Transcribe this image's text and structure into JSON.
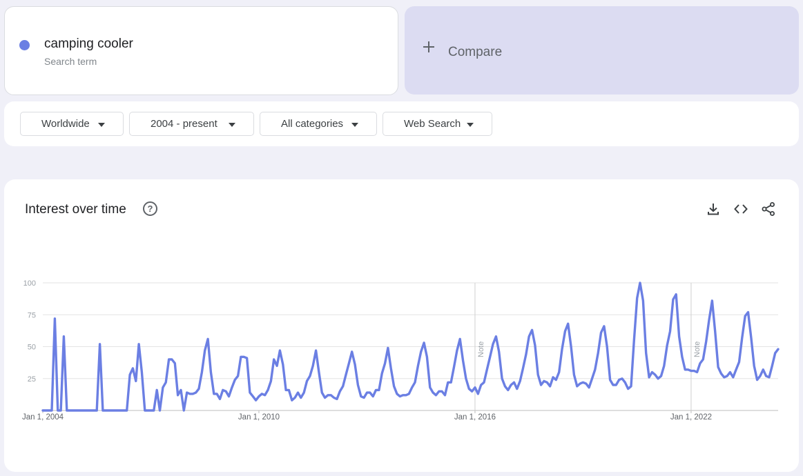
{
  "search_term": {
    "name": "camping cooler",
    "subtitle": "Search term",
    "color": "#6b7fe3"
  },
  "compare": {
    "label": "Compare"
  },
  "filters": [
    {
      "label": "Worldwide"
    },
    {
      "label": "2004 - present"
    },
    {
      "label": "All categories"
    },
    {
      "label": "Web Search"
    }
  ],
  "panel": {
    "title": "Interest over time",
    "icons": [
      "help-icon",
      "download-icon",
      "embed-code-icon",
      "share-icon"
    ]
  },
  "chart_data": {
    "type": "line",
    "xlim": [
      "2004-01",
      "2024-06"
    ],
    "ylim": [
      0,
      100
    ],
    "yticks": [
      "100",
      "75",
      "50",
      "25"
    ],
    "xticks": [
      {
        "date": "2004-01",
        "label": "Jan 1, 2004"
      },
      {
        "date": "2010-01",
        "label": "Jan 1, 2010"
      },
      {
        "date": "2016-01",
        "label": "Jan 1, 2016"
      },
      {
        "date": "2022-01",
        "label": "Jan 1, 2022"
      }
    ],
    "notes": [
      {
        "date": "2016-01",
        "label": "Note"
      },
      {
        "date": "2022-01",
        "label": "Note"
      }
    ],
    "series": [
      {
        "color": "#6b7fe3",
        "points": [
          [
            "2004-01",
            0
          ],
          [
            "2004-03",
            0
          ],
          [
            "2004-04",
            0
          ],
          [
            "2004-05",
            72
          ],
          [
            "2004-06",
            0
          ],
          [
            "2004-07",
            0
          ],
          [
            "2004-08",
            58
          ],
          [
            "2004-09",
            0
          ],
          [
            "2005-06",
            0
          ],
          [
            "2005-07",
            0
          ],
          [
            "2005-08",
            52
          ],
          [
            "2005-09",
            0
          ],
          [
            "2006-05",
            0
          ],
          [
            "2006-06",
            28
          ],
          [
            "2006-07",
            33
          ],
          [
            "2006-08",
            23
          ],
          [
            "2006-09",
            52
          ],
          [
            "2006-10",
            30
          ],
          [
            "2006-11",
            0
          ],
          [
            "2006-12",
            0
          ],
          [
            "2007-02",
            0
          ],
          [
            "2007-03",
            16
          ],
          [
            "2007-04",
            0
          ],
          [
            "2007-05",
            18
          ],
          [
            "2007-06",
            22
          ],
          [
            "2007-07",
            40
          ],
          [
            "2007-08",
            40
          ],
          [
            "2007-09",
            37
          ],
          [
            "2007-10",
            12
          ],
          [
            "2007-11",
            16
          ],
          [
            "2007-12",
            0
          ],
          [
            "2008-01",
            14
          ],
          [
            "2008-02",
            13
          ],
          [
            "2008-03",
            13
          ],
          [
            "2008-04",
            14
          ],
          [
            "2008-05",
            17
          ],
          [
            "2008-06",
            30
          ],
          [
            "2008-07",
            47
          ],
          [
            "2008-08",
            56
          ],
          [
            "2008-09",
            30
          ],
          [
            "2008-10",
            13
          ],
          [
            "2008-11",
            13
          ],
          [
            "2008-12",
            9
          ],
          [
            "2009-01",
            16
          ],
          [
            "2009-02",
            15
          ],
          [
            "2009-03",
            11
          ],
          [
            "2009-04",
            18
          ],
          [
            "2009-05",
            24
          ],
          [
            "2009-06",
            27
          ],
          [
            "2009-07",
            42
          ],
          [
            "2009-08",
            42
          ],
          [
            "2009-09",
            41
          ],
          [
            "2009-10",
            14
          ],
          [
            "2009-11",
            11
          ],
          [
            "2009-12",
            8
          ],
          [
            "2010-01",
            11
          ],
          [
            "2010-02",
            13
          ],
          [
            "2010-03",
            12
          ],
          [
            "2010-04",
            16
          ],
          [
            "2010-05",
            23
          ],
          [
            "2010-06",
            40
          ],
          [
            "2010-07",
            35
          ],
          [
            "2010-08",
            47
          ],
          [
            "2010-09",
            36
          ],
          [
            "2010-10",
            16
          ],
          [
            "2010-11",
            16
          ],
          [
            "2010-12",
            8
          ],
          [
            "2011-01",
            10
          ],
          [
            "2011-02",
            14
          ],
          [
            "2011-03",
            10
          ],
          [
            "2011-04",
            14
          ],
          [
            "2011-05",
            23
          ],
          [
            "2011-06",
            27
          ],
          [
            "2011-07",
            35
          ],
          [
            "2011-08",
            47
          ],
          [
            "2011-09",
            30
          ],
          [
            "2011-10",
            14
          ],
          [
            "2011-11",
            10
          ],
          [
            "2011-12",
            12
          ],
          [
            "2012-01",
            12
          ],
          [
            "2012-02",
            10
          ],
          [
            "2012-03",
            9
          ],
          [
            "2012-04",
            15
          ],
          [
            "2012-05",
            19
          ],
          [
            "2012-06",
            28
          ],
          [
            "2012-07",
            37
          ],
          [
            "2012-08",
            46
          ],
          [
            "2012-09",
            36
          ],
          [
            "2012-10",
            20
          ],
          [
            "2012-11",
            11
          ],
          [
            "2012-12",
            10
          ],
          [
            "2013-01",
            14
          ],
          [
            "2013-02",
            14
          ],
          [
            "2013-03",
            11
          ],
          [
            "2013-04",
            16
          ],
          [
            "2013-05",
            16
          ],
          [
            "2013-06",
            29
          ],
          [
            "2013-07",
            37
          ],
          [
            "2013-08",
            49
          ],
          [
            "2013-09",
            33
          ],
          [
            "2013-10",
            19
          ],
          [
            "2013-11",
            13
          ],
          [
            "2013-12",
            11
          ],
          [
            "2014-01",
            12
          ],
          [
            "2014-02",
            12
          ],
          [
            "2014-03",
            13
          ],
          [
            "2014-04",
            18
          ],
          [
            "2014-05",
            22
          ],
          [
            "2014-06",
            35
          ],
          [
            "2014-07",
            46
          ],
          [
            "2014-08",
            53
          ],
          [
            "2014-09",
            42
          ],
          [
            "2014-10",
            18
          ],
          [
            "2014-11",
            14
          ],
          [
            "2014-12",
            12
          ],
          [
            "2015-01",
            15
          ],
          [
            "2015-02",
            15
          ],
          [
            "2015-03",
            12
          ],
          [
            "2015-04",
            22
          ],
          [
            "2015-05",
            22
          ],
          [
            "2015-06",
            34
          ],
          [
            "2015-07",
            47
          ],
          [
            "2015-08",
            56
          ],
          [
            "2015-09",
            39
          ],
          [
            "2015-10",
            25
          ],
          [
            "2015-11",
            17
          ],
          [
            "2015-12",
            15
          ],
          [
            "2016-01",
            18
          ],
          [
            "2016-02",
            13
          ],
          [
            "2016-03",
            20
          ],
          [
            "2016-04",
            22
          ],
          [
            "2016-05",
            32
          ],
          [
            "2016-06",
            42
          ],
          [
            "2016-07",
            52
          ],
          [
            "2016-08",
            58
          ],
          [
            "2016-09",
            46
          ],
          [
            "2016-10",
            25
          ],
          [
            "2016-11",
            19
          ],
          [
            "2016-12",
            16
          ],
          [
            "2017-01",
            20
          ],
          [
            "2017-02",
            22
          ],
          [
            "2017-03",
            17
          ],
          [
            "2017-04",
            23
          ],
          [
            "2017-05",
            33
          ],
          [
            "2017-06",
            44
          ],
          [
            "2017-07",
            58
          ],
          [
            "2017-08",
            63
          ],
          [
            "2017-09",
            51
          ],
          [
            "2017-10",
            28
          ],
          [
            "2017-11",
            20
          ],
          [
            "2017-12",
            23
          ],
          [
            "2018-01",
            22
          ],
          [
            "2018-02",
            19
          ],
          [
            "2018-03",
            26
          ],
          [
            "2018-04",
            24
          ],
          [
            "2018-05",
            30
          ],
          [
            "2018-06",
            48
          ],
          [
            "2018-07",
            62
          ],
          [
            "2018-08",
            68
          ],
          [
            "2018-09",
            50
          ],
          [
            "2018-10",
            28
          ],
          [
            "2018-11",
            19
          ],
          [
            "2018-12",
            21
          ],
          [
            "2019-01",
            22
          ],
          [
            "2019-02",
            21
          ],
          [
            "2019-03",
            18
          ],
          [
            "2019-04",
            25
          ],
          [
            "2019-05",
            32
          ],
          [
            "2019-06",
            45
          ],
          [
            "2019-07",
            61
          ],
          [
            "2019-08",
            66
          ],
          [
            "2019-09",
            50
          ],
          [
            "2019-10",
            24
          ],
          [
            "2019-11",
            20
          ],
          [
            "2019-12",
            20
          ],
          [
            "2020-01",
            24
          ],
          [
            "2020-02",
            25
          ],
          [
            "2020-03",
            22
          ],
          [
            "2020-04",
            17
          ],
          [
            "2020-05",
            19
          ],
          [
            "2020-06",
            55
          ],
          [
            "2020-07",
            88
          ],
          [
            "2020-08",
            100
          ],
          [
            "2020-09",
            86
          ],
          [
            "2020-10",
            45
          ],
          [
            "2020-11",
            26
          ],
          [
            "2020-12",
            30
          ],
          [
            "2021-01",
            28
          ],
          [
            "2021-02",
            25
          ],
          [
            "2021-03",
            27
          ],
          [
            "2021-04",
            35
          ],
          [
            "2021-05",
            51
          ],
          [
            "2021-06",
            62
          ],
          [
            "2021-07",
            87
          ],
          [
            "2021-08",
            91
          ],
          [
            "2021-09",
            58
          ],
          [
            "2021-10",
            42
          ],
          [
            "2021-11",
            32
          ],
          [
            "2021-12",
            32
          ],
          [
            "2022-01",
            31
          ],
          [
            "2022-02",
            31
          ],
          [
            "2022-03",
            30
          ],
          [
            "2022-04",
            37
          ],
          [
            "2022-05",
            40
          ],
          [
            "2022-06",
            54
          ],
          [
            "2022-07",
            71
          ],
          [
            "2022-08",
            86
          ],
          [
            "2022-09",
            62
          ],
          [
            "2022-10",
            34
          ],
          [
            "2022-11",
            29
          ],
          [
            "2022-12",
            26
          ],
          [
            "2023-01",
            27
          ],
          [
            "2023-02",
            30
          ],
          [
            "2023-03",
            26
          ],
          [
            "2023-04",
            32
          ],
          [
            "2023-05",
            38
          ],
          [
            "2023-06",
            57
          ],
          [
            "2023-07",
            74
          ],
          [
            "2023-08",
            77
          ],
          [
            "2023-09",
            57
          ],
          [
            "2023-10",
            35
          ],
          [
            "2023-11",
            24
          ],
          [
            "2023-12",
            27
          ],
          [
            "2024-01",
            32
          ],
          [
            "2024-02",
            27
          ],
          [
            "2024-03",
            26
          ],
          [
            "2024-04",
            35
          ],
          [
            "2024-05",
            45
          ],
          [
            "2024-06",
            48
          ]
        ]
      }
    ]
  }
}
